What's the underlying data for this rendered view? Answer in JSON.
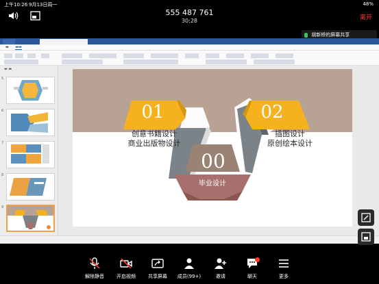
{
  "status_bar": {
    "time": "上午10:26",
    "date": "9月13日周一",
    "battery": "48%"
  },
  "call": {
    "meeting_id": "555 487 761",
    "duration": "30:28",
    "leave_label": "离开"
  },
  "share_banner": {
    "text": "胡新桥的屏幕共享"
  },
  "slide": {
    "label_01": "01",
    "label_02": "02",
    "label_00": "00",
    "left_line1": "创意书籍设计",
    "left_line2": "商业出版物设计",
    "right_line1": "插图设计",
    "right_line2": "原创绘本设计",
    "center_caption": "毕业设计"
  },
  "thumbnails": [
    {
      "num": "5"
    },
    {
      "num": "6"
    },
    {
      "num": "7"
    },
    {
      "num": "8"
    },
    {
      "num": "9"
    }
  ],
  "toolbar": {
    "items": [
      {
        "label": "解除静音",
        "icon": "muted-mic-icon"
      },
      {
        "label": "开启视频",
        "icon": "video-off-icon"
      },
      {
        "label": "共享屏幕",
        "icon": "share-screen-icon"
      },
      {
        "label": "成员(99+)",
        "icon": "participants-icon"
      },
      {
        "label": "邀请",
        "icon": "invite-icon"
      },
      {
        "label": "聊天",
        "icon": "chat-icon"
      },
      {
        "label": "更多",
        "icon": "more-icon"
      }
    ]
  },
  "colors": {
    "accent_red": "#ff3b30",
    "slide_gold": "#f5b21e",
    "slide_taupe": "#b8a293",
    "slide_gray": "#7b8388",
    "slide_rose": "#a7706c"
  }
}
